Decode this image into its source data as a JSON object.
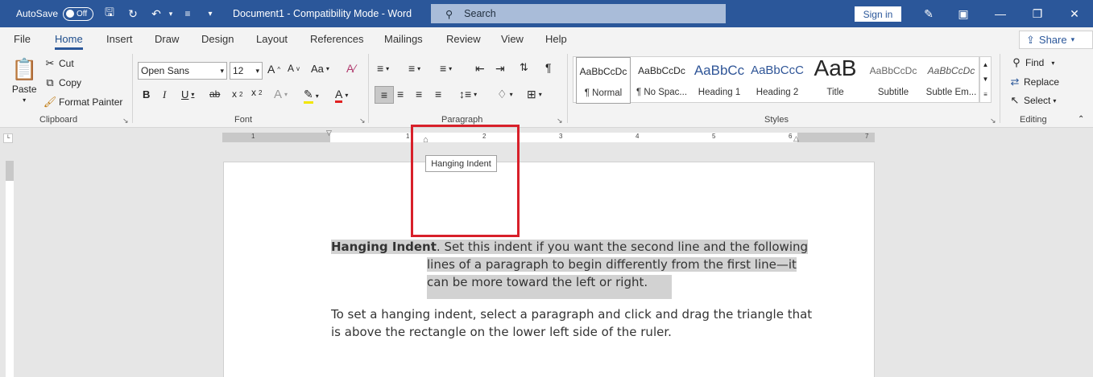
{
  "title_bar": {
    "autosave_label": "AutoSave",
    "autosave_state": "Off",
    "doc_title": "Document1  -  Compatibility Mode  -  Word",
    "search_placeholder": "Search",
    "signin_label": "Sign in",
    "colors": {
      "bar": "#2b579a",
      "search": "#a9bcd9"
    }
  },
  "tabs": [
    {
      "label": "File"
    },
    {
      "label": "Home"
    },
    {
      "label": "Insert"
    },
    {
      "label": "Draw"
    },
    {
      "label": "Design"
    },
    {
      "label": "Layout"
    },
    {
      "label": "References"
    },
    {
      "label": "Mailings"
    },
    {
      "label": "Review"
    },
    {
      "label": "View"
    },
    {
      "label": "Help"
    }
  ],
  "active_tab": "Home",
  "share_label": "Share",
  "clipboard": {
    "paste": "Paste",
    "cut": "Cut",
    "copy": "Copy",
    "format_painter": "Format Painter",
    "group": "Clipboard"
  },
  "font": {
    "name": "Open Sans",
    "size": "12",
    "group": "Font"
  },
  "paragraph": {
    "group": "Paragraph"
  },
  "styles": {
    "group": "Styles",
    "items": [
      {
        "sample": "AaBbCcDc",
        "name": "¶ Normal"
      },
      {
        "sample": "AaBbCcDc",
        "name": "¶ No Spac..."
      },
      {
        "sample": "AaBbCc",
        "name": "Heading 1"
      },
      {
        "sample": "AaBbCcC",
        "name": "Heading 2"
      },
      {
        "sample": "AaB",
        "name": "Title"
      },
      {
        "sample": "AaBbCcDc",
        "name": "Subtitle"
      },
      {
        "sample": "AaBbCcDc",
        "name": "Subtle Em..."
      }
    ]
  },
  "editing": {
    "find": "Find",
    "replace": "Replace",
    "select": "Select",
    "group": "Editing"
  },
  "ruler_numbers": [
    "1",
    "1",
    "2",
    "3",
    "4",
    "5",
    "6",
    "7"
  ],
  "tooltip": "Hanging Indent",
  "document": {
    "para1_bold": "Hanging Indent",
    "para1_line1": ". Set this indent if you want the second line and the following",
    "para1_line2": "lines of a paragraph to begin differently from the first line—it",
    "para1_line3": "can be more toward the left or right.",
    "para2_line1": "To set a hanging indent, select a paragraph and click and drag the triangle that",
    "para2_line2": "is above the rectangle on the lower left side of the ruler."
  },
  "highlight_color": "#d2d2d2",
  "annotation_color": "#d8202a"
}
